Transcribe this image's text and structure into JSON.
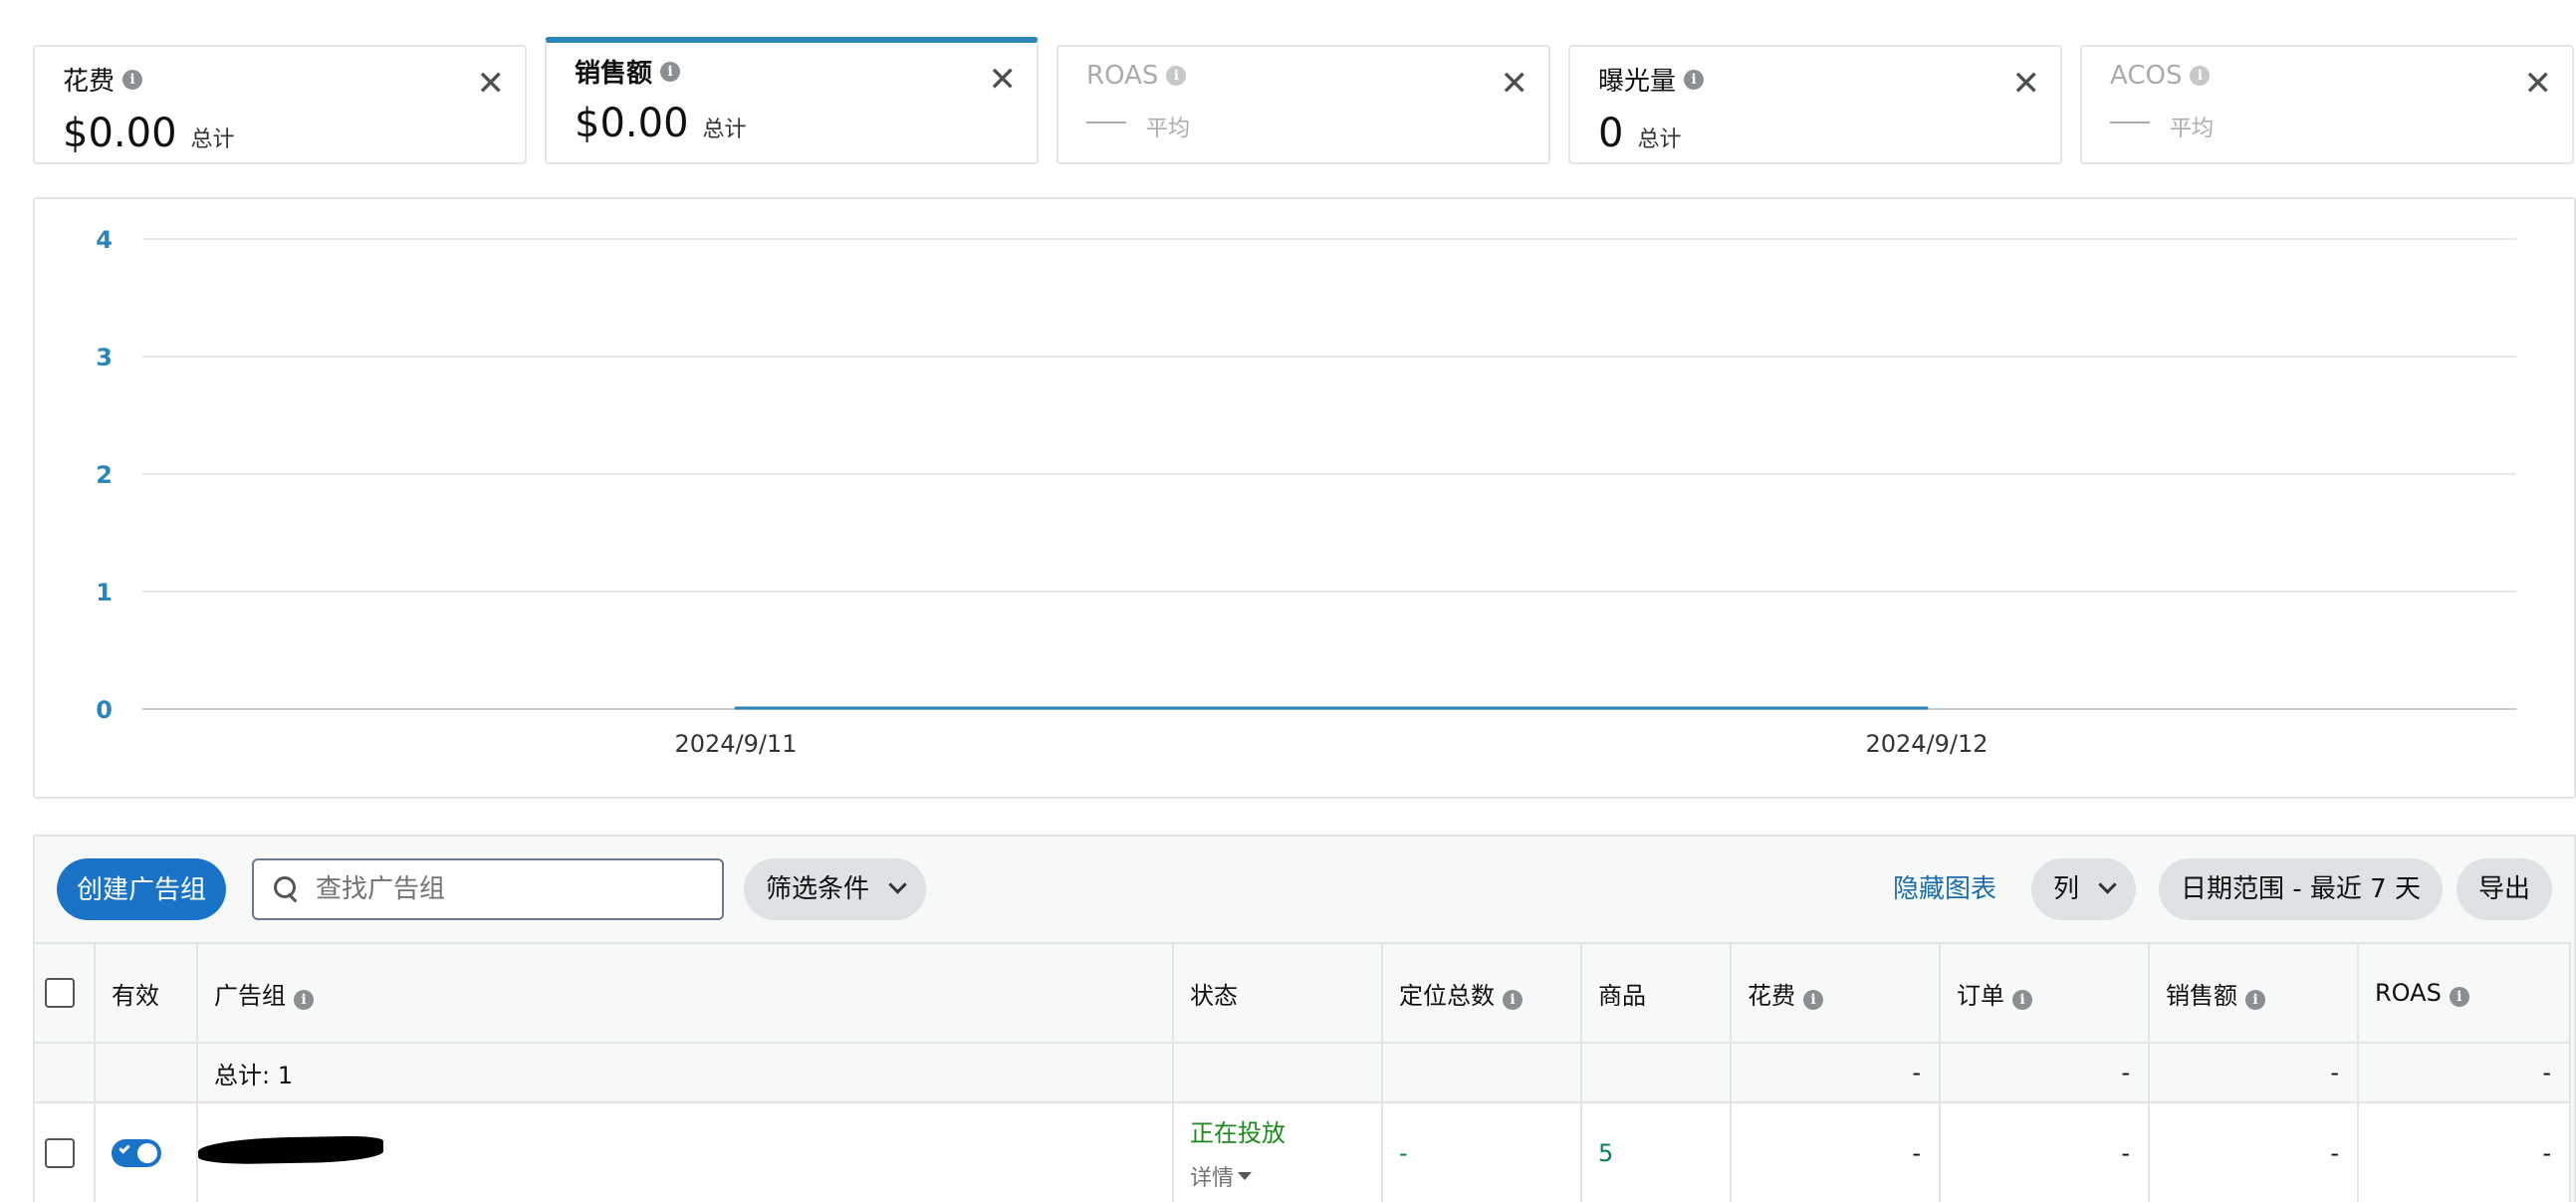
{
  "metric_cards": [
    {
      "label": "花费",
      "value": "$0.00",
      "unit": "总计",
      "state": "enabled"
    },
    {
      "label": "销售额",
      "value": "$0.00",
      "unit": "总计",
      "state": "active"
    },
    {
      "label": "ROAS",
      "value": "",
      "unit": "平均",
      "state": "disabled"
    },
    {
      "label": "曝光量",
      "value": "0",
      "unit": "总计",
      "state": "enabled"
    },
    {
      "label": "ACOS",
      "value": "",
      "unit": "平均",
      "state": "disabled"
    }
  ],
  "chart_data": {
    "type": "line",
    "x": [
      "2024/9/11",
      "2024/9/12"
    ],
    "series": [
      {
        "values": [
          0,
          0
        ],
        "color": "#2b86b8"
      }
    ],
    "yticks": [
      "0",
      "1",
      "2",
      "3",
      "4"
    ],
    "ylim": [
      0,
      4
    ],
    "grid": true,
    "title": "",
    "xlabel": "",
    "ylabel": ""
  },
  "toolbar": {
    "create_label": "创建广告组",
    "search_placeholder": "查找广告组",
    "filter_label": "筛选条件",
    "hide_chart_label": "隐藏图表",
    "columns_label": "列",
    "date_range_label": "日期范围 - 最近 7 天",
    "export_label": "导出"
  },
  "table": {
    "headers": {
      "active": "有效",
      "ad_group": "广告组",
      "status": "状态",
      "targeting": "定位总数",
      "products": "商品",
      "spend": "花费",
      "orders": "订单",
      "sales": "销售额",
      "roas": "ROAS"
    },
    "total_row": {
      "label": "总计: 1",
      "spend": "-",
      "orders": "-",
      "sales": "-",
      "roas": "-"
    },
    "rows": [
      {
        "status": "正在投放",
        "details": "详情",
        "targeting": "-",
        "products": "5",
        "spend": "-",
        "orders": "-",
        "sales": "-",
        "roas": "-"
      }
    ]
  },
  "colors": {
    "accent": "#2b86b8",
    "primary_button": "#1a73c6",
    "live_status": "#1d8a1d"
  }
}
